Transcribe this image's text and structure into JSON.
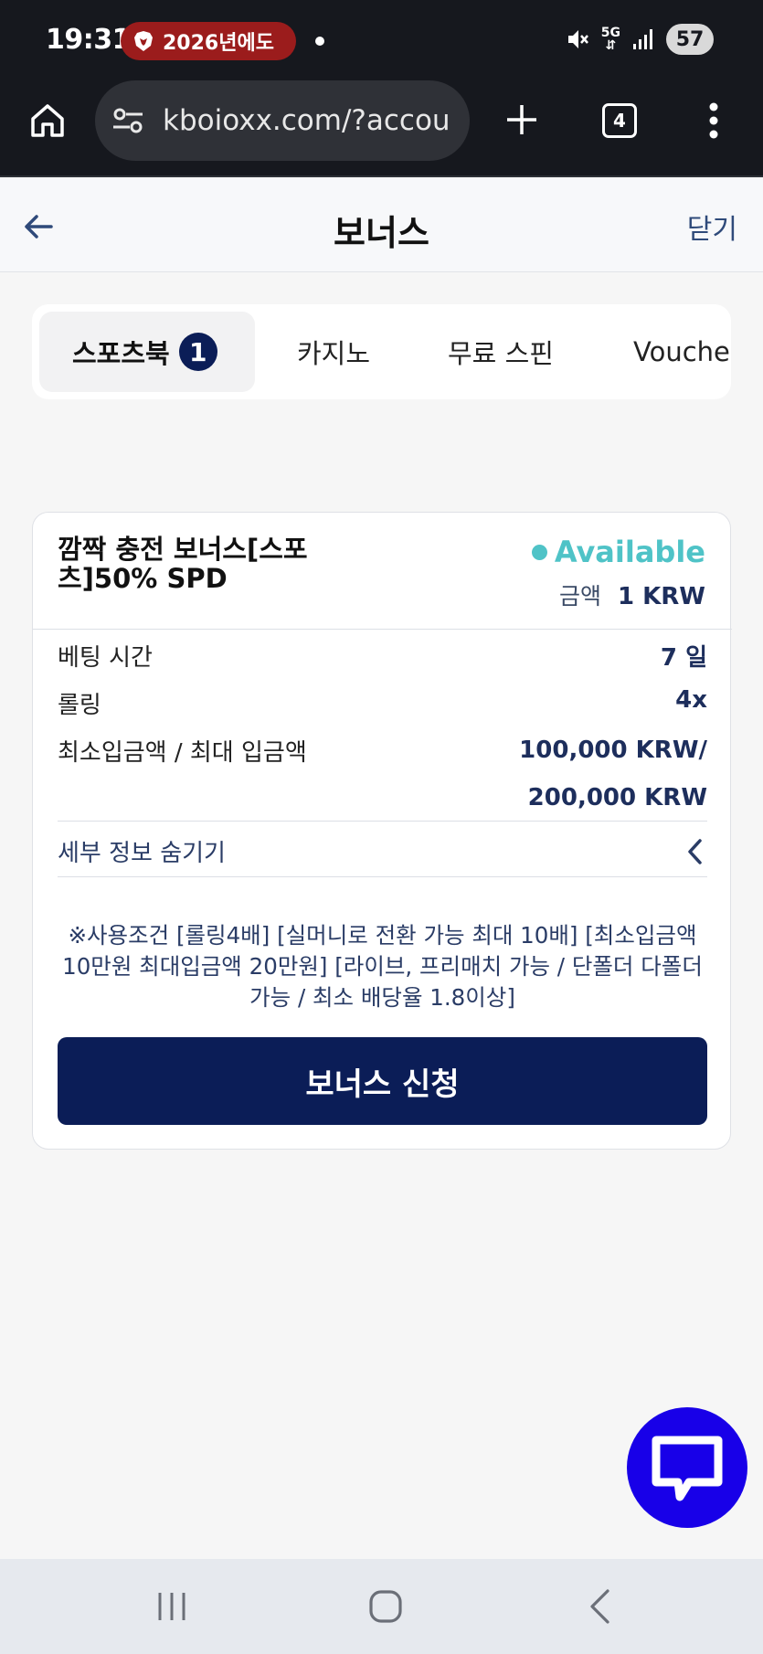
{
  "status_bar": {
    "time": "19:31",
    "notification_text": "2026년에도",
    "network_label": "5G",
    "battery": "57"
  },
  "browser": {
    "url": "kboioxx.com/?accou",
    "tab_count": "4"
  },
  "header": {
    "title": "보너스",
    "close_label": "닫기"
  },
  "tabs": [
    {
      "label": "스포츠북",
      "badge": "1",
      "active": true
    },
    {
      "label": "카지노"
    },
    {
      "label": "무료 스핀"
    },
    {
      "label": "Voucher"
    }
  ],
  "bonus_card": {
    "title": "깜짝 충전 보너스[스포츠]50% SPD",
    "status": "Available",
    "amount_label": "금액",
    "amount_value": "1 KRW",
    "details": [
      {
        "label": "베팅 시간",
        "value": "7 일"
      },
      {
        "label": "롤링",
        "value": "4x"
      },
      {
        "label": "최소입금액 / 최대 입금액",
        "value": "100,000 KRW/ 200,000 KRW"
      }
    ],
    "toggle_label": "세부 정보 숨기기",
    "note": "※사용조건 [롤링4배] [실머니로 전환 가능 최대 10배] [최소입금액 10만원 최대입금액 20만원] [라이브, 프리매치 가능 / 단폴더 다폴더 가능 / 최소 배당율 1.8이상]",
    "apply_button": "보너스 신청"
  },
  "icons": {
    "status": [
      "brave-icon",
      "mute-icon",
      "signal-icon"
    ],
    "browser": [
      "home-icon",
      "site-settings-icon",
      "new-tab-icon",
      "tab-switcher-icon",
      "more-menu-icon"
    ],
    "page": [
      "back-arrow-icon",
      "chevron-left-icon",
      "chat-icon"
    ],
    "nav": [
      "recents-icon",
      "home-nav-icon",
      "back-nav-icon"
    ]
  },
  "colors": {
    "primary": "#0b1d57",
    "available": "#4fc3c7",
    "chat_fab": "#1800e8",
    "notification_pill": "#9b1c1c"
  }
}
